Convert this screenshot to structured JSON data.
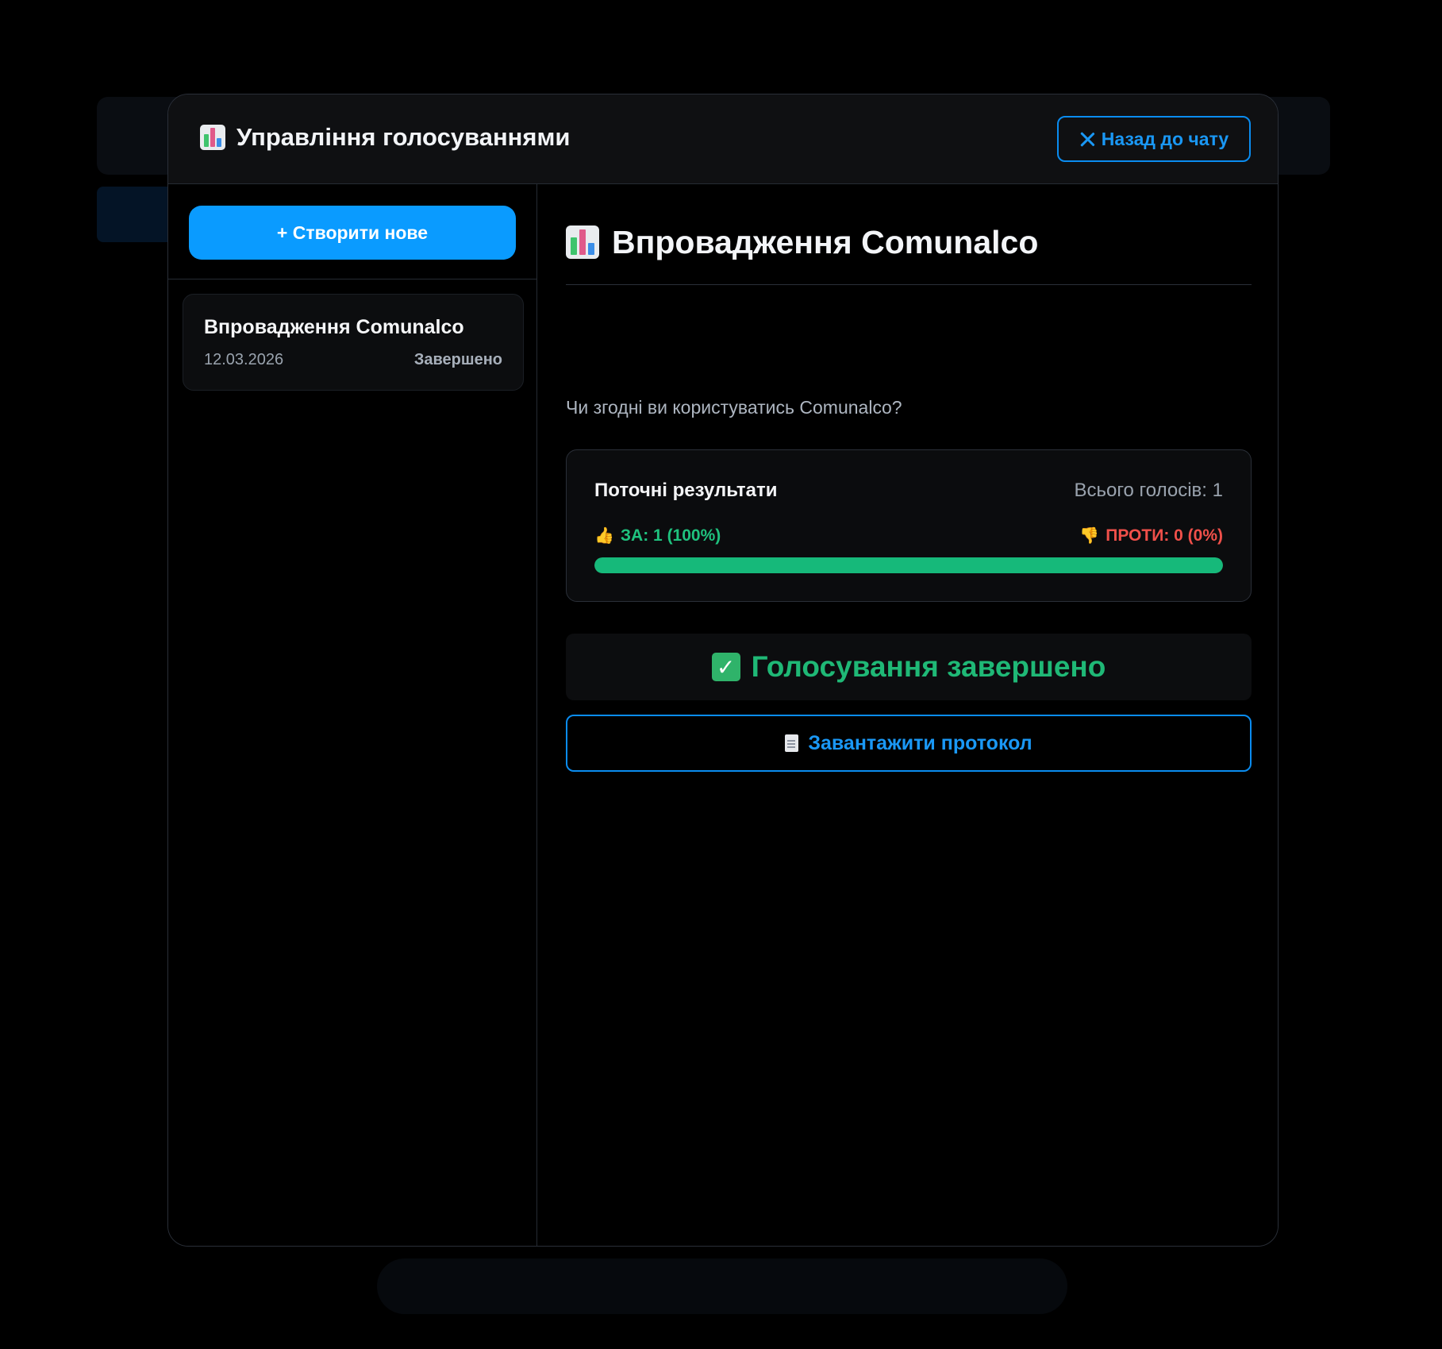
{
  "header": {
    "title": "Управління голосуваннями",
    "back_label": "Назад до чату"
  },
  "sidebar": {
    "create_label": "+ Створити нове",
    "polls": [
      {
        "title": "Впровадження Comunalco",
        "date": "12.03.2026",
        "status": "Завершено"
      }
    ]
  },
  "poll": {
    "title": "Впровадження Comunalco",
    "question": "Чи згодні ви користуватись Comunalco?",
    "results": {
      "title": "Поточні результати",
      "total_label": "Всього голосів: 1",
      "for_label": "ЗА: 1 (100%)",
      "against_label": "ПРОТИ: 0 (0%)",
      "for_fraction": 1.0
    },
    "status_text": "Голосування завершено",
    "download_label": "Завантажити протокол"
  },
  "colors": {
    "accent": "#0a9bff",
    "success": "#16b97a",
    "danger": "#f0504a"
  },
  "icons": {
    "header": "bar-chart-icon",
    "back": "close-icon",
    "for": "thumbs-up-icon",
    "against": "thumbs-down-icon",
    "status": "check-mark-icon",
    "download": "document-icon"
  }
}
